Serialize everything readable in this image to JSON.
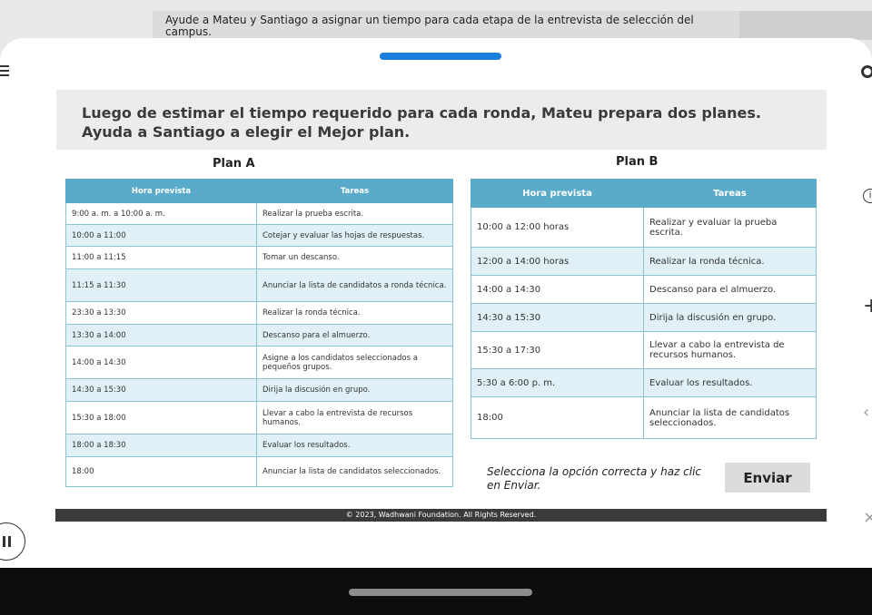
{
  "banner": {
    "text": "Ayude a Mateu y Santiago a asignar un tiempo para cada etapa de la entrevista de selección del campus."
  },
  "question": {
    "text": "Luego de estimar el tiempo requerido para cada ronda, Mateu prepara dos planes. Ayuda a Santiago a elegir el Mejor plan."
  },
  "plan_a": {
    "title": "Plan A",
    "headers": [
      "Hora prevista",
      "Tareas"
    ],
    "rows": [
      {
        "time": "9:00 a. m. a 10:00 a. m.",
        "task": "Realizar la prueba escrita."
      },
      {
        "time": "10:00 a 11:00",
        "task": "Cotejar y evaluar las hojas de respuestas."
      },
      {
        "time": "11:00 a 11:15",
        "task": "Tomar un descanso."
      },
      {
        "time": "11:15 a 11:30",
        "task": "Anunciar la lista de candidatos a ronda técnica."
      },
      {
        "time": "23:30 a 13:30",
        "task": "Realizar la ronda técnica."
      },
      {
        "time": "13:30 a 14:00",
        "task": "Descanso para el almuerzo."
      },
      {
        "time": "14:00 a 14:30",
        "task": "Asigne a los candidatos seleccionados a pequeños grupos."
      },
      {
        "time": "14:30 a 15:30",
        "task": "Dirija la discusión en grupo."
      },
      {
        "time": "15:30 a 18:00",
        "task": "Llevar a cabo la entrevista de recursos humanos."
      },
      {
        "time": "18:00 a 18:30",
        "task": "Evaluar los resultados."
      },
      {
        "time": "18:00",
        "task": "Anunciar la lista de candidatos seleccionados."
      }
    ]
  },
  "plan_b": {
    "title": "Plan B",
    "headers": [
      "Hora prevista",
      "Tareas"
    ],
    "rows": [
      {
        "time": "10:00 a 12:00 horas",
        "task": "Realizar y evaluar la prueba escrita."
      },
      {
        "time": "12:00 a 14:00 horas",
        "task": "Realizar la ronda técnica."
      },
      {
        "time": "14:00 a 14:30",
        "task": "Descanso para el almuerzo."
      },
      {
        "time": "14:30 a 15:30",
        "task": "Dirija la discusión en grupo."
      },
      {
        "time": "15:30 a 17:30",
        "task": "Llevar a cabo la entrevista de recursos humanos."
      },
      {
        "time": "5:30 a 6:00 p. m.",
        "task": "Evaluar los resultados."
      },
      {
        "time": "18:00",
        "task": "Anunciar la lista de candidatos seleccionados."
      }
    ]
  },
  "instruction": "Selecciona la opción correcta y haz clic en Enviar.",
  "submit_label": "Enviar",
  "footer": "© 2023, Wadhwani Foundation. All Rights Reserved.",
  "colors": {
    "table_header": "#5aabc9",
    "row_alt": "#e0f0f6",
    "progress": "#1b7fdc"
  },
  "icons": [
    "menu-icon",
    "gear-icon",
    "info-icon",
    "plus-icon",
    "pause-icon",
    "left-arrow-icon",
    "close-icon"
  ]
}
